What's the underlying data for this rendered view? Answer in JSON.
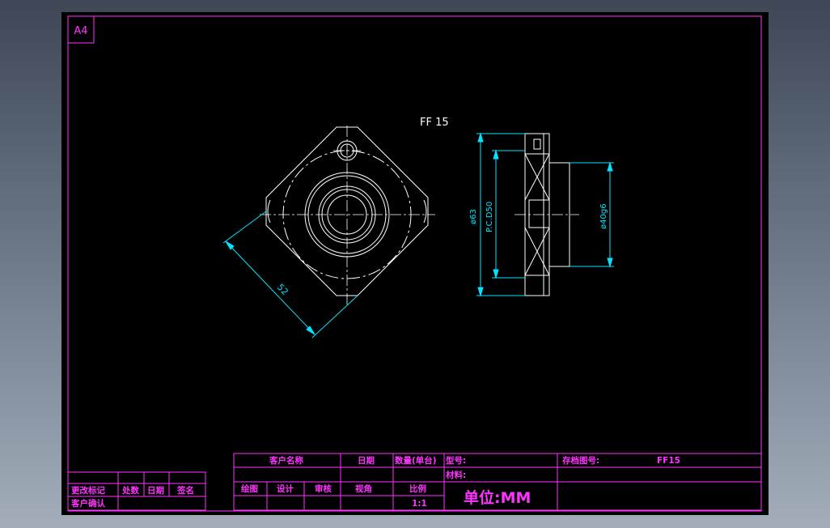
{
  "sheet": {
    "size": "A4"
  },
  "part": {
    "model": "FF 15",
    "dim_side": "52",
    "dim_outer_dia": "ø63",
    "dim_pcd": "P.C.D50",
    "dim_pilot": "ø40g6"
  },
  "title_block": {
    "customer_name": "客户名称",
    "date": "日期",
    "quantity": "数量(单台)",
    "model_no": "型号:",
    "drawing_no": "存档图号:",
    "drawing_no_value": "FF15",
    "material": "材料:",
    "drawn": "绘图",
    "design": "设计",
    "review": "审核",
    "view_angle": "视角",
    "scale": "比例",
    "scale_value": "1:1",
    "unit": "单位:MM"
  },
  "revision_block": {
    "change_mark": "更改标记",
    "division": "处数",
    "date": "日期",
    "signature": "签名",
    "customer_confirm": "客户确认"
  },
  "colors": {
    "frame": "#ff33ff",
    "geometry": "#ffffff",
    "dimension": "#00e5ff",
    "background": "#000000"
  }
}
